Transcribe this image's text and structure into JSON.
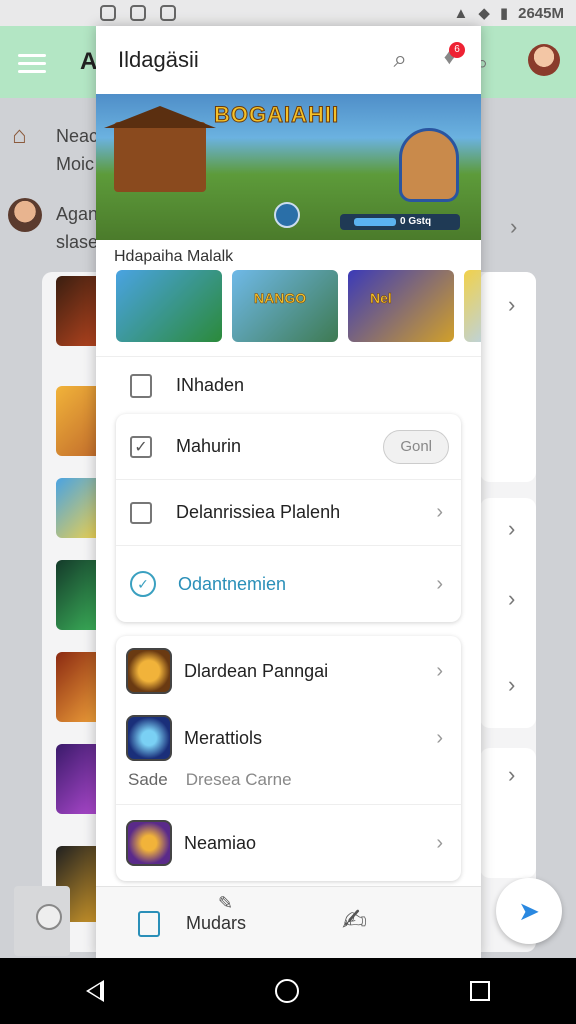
{
  "status_bar": {
    "time": "2645M"
  },
  "background": {
    "title": "A",
    "row1": [
      "Neac",
      "Moic"
    ],
    "row2": [
      "Agan",
      "slase"
    ]
  },
  "panel": {
    "title": "Ildagäsii",
    "badge": "6",
    "hero": {
      "title": "BOGAIAHII",
      "bar_value": "0 Gstq"
    },
    "section_label": "Hdapaiha Malalk",
    "thumbs": [
      {
        "label": ""
      },
      {
        "label": "NANGO"
      },
      {
        "label": "Nel"
      },
      {
        "label": ""
      }
    ],
    "menu_item": "INhaden",
    "card1": [
      {
        "label": "Mahurin",
        "button": "Gonl"
      },
      {
        "label": "Delanrissiea Plalenh"
      },
      {
        "label": "Odantnemien"
      }
    ],
    "card2": [
      {
        "label": "Dlardean Panngai"
      },
      {
        "label": "Merattiols"
      }
    ],
    "subrow": {
      "left": "Sade",
      "right": "Dresea Carne"
    },
    "card2_last": {
      "label": "Neamiao"
    },
    "bottom_nav": {
      "label": "Mudars"
    }
  },
  "colors": {
    "accent": "#2a8fb8",
    "appbar": "#b3e6c4",
    "badge": "#e23"
  }
}
